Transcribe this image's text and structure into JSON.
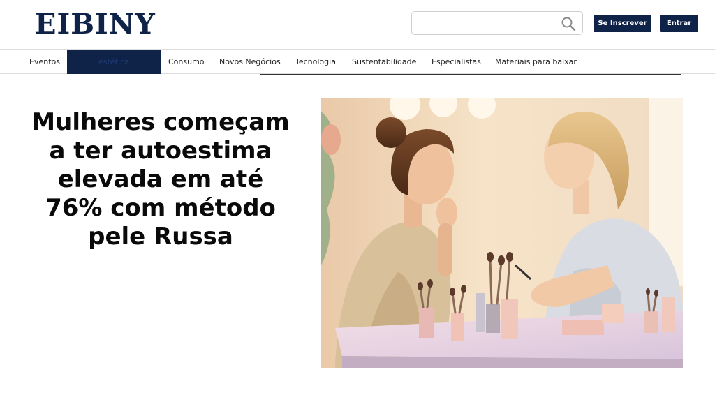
{
  "header": {
    "logo": "EIBINY",
    "search": {
      "placeholder": "",
      "value": ""
    },
    "subscribe_label": "Se Inscrever",
    "login_label": "Entrar"
  },
  "nav": {
    "items": [
      {
        "label": "Eventos"
      },
      {
        "label": "estética"
      },
      {
        "label": "Consumo"
      },
      {
        "label": "Novos Negócios"
      },
      {
        "label": "Tecnologia"
      },
      {
        "label": "Sustentabilidade"
      },
      {
        "label": "Especialistas"
      },
      {
        "label": "Materiais para baixar"
      }
    ],
    "active": "estética"
  },
  "article": {
    "headline_lines": [
      "Mulheres começam",
      "a ter autoestima",
      "elevada em até",
      "76% com método",
      "pele Russa"
    ],
    "image_icon": "illustration-two-women-makeup-mirror"
  },
  "colors": {
    "brand_navy": "#0f2247",
    "white": "#ffffff"
  }
}
